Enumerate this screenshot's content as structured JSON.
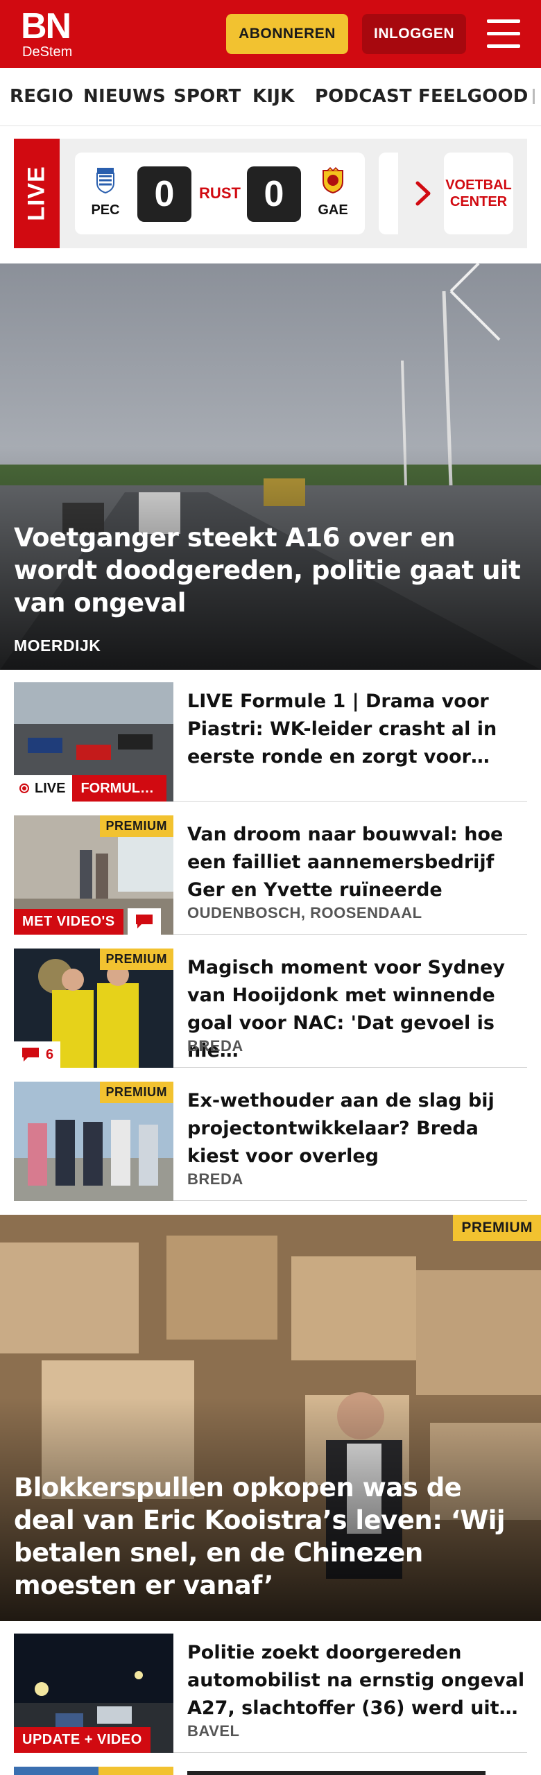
{
  "header": {
    "logo_main": "BN",
    "logo_sub": "DeStem",
    "subscribe_label": "ABONNEREN",
    "login_label": "INLOGGEN"
  },
  "nav": {
    "items": [
      "REGIO",
      "NIEUWS",
      "SPORT",
      "KIJK",
      "PODCAST",
      "FEELGOOD"
    ]
  },
  "live": {
    "tab_label": "LIVE",
    "match": {
      "home_team": "PEC",
      "away_team": "GAE",
      "home_score": "0",
      "away_score": "0",
      "status": "RUST"
    },
    "voetbal_center_label": "VOETBAL CENTER"
  },
  "hero": {
    "title": "Voetganger steekt A16 over en wordt doodgereden, politie gaat uit van ongeval",
    "location": "MOERDIJK"
  },
  "articles": [
    {
      "title": "LIVE Formule 1 | Drama voor Piastri: WK-leider crasht al in eerste ronde en zorgt voor…",
      "live_label": "LIVE",
      "category": "FORMUL…"
    },
    {
      "title": "Van droom naar bouwval: hoe een failliet aannemersbedrijf Ger en Yvette ruïneerde",
      "location": "OUDENBOSCH, ROOSENDAAL",
      "premium": "PREMIUM",
      "badge": "MET VIDEO'S"
    },
    {
      "title": "Magisch moment voor Sydney van Hooijdonk met winnende goal voor NAC: 'Dat gevoel is nie…",
      "location": "BREDA",
      "premium": "PREMIUM",
      "comments": "6"
    },
    {
      "title": "Ex-wethouder aan de slag bij projectontwikkelaar? Breda kiest voor overleg",
      "location": "BREDA",
      "premium": "PREMIUM"
    }
  ],
  "feature": {
    "title": "Blokkerspullen opkopen was de deal van Eric Kooistra’s leven: ‘Wij betalen snel, en de Chinezen moesten er vanaf’",
    "premium": "PREMIUM"
  },
  "article5": {
    "title": "Politie zoekt doorgereden automobilist na ernstig ongeval A27, slachtoffer (36) werd uit…",
    "location": "BAVEL",
    "badge": "UPDATE + VIDEO"
  },
  "colors": {
    "brand_red": "#d10a11",
    "premium_yellow": "#f2c230",
    "login_dark_red": "#a7080e"
  }
}
